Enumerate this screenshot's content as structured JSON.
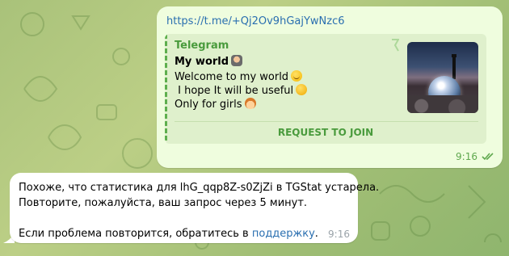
{
  "outgoing": {
    "link": "https://t.me/+Qj2Ov9hGajYwNzc6",
    "preview": {
      "site": "Telegram",
      "title": "My world",
      "lines": [
        "Welcome to my world",
        " I hope It will be useful",
        "Only for girls"
      ],
      "button": "REQUEST TO JOIN"
    },
    "time": "9:16",
    "status_icon": "double-check-icon"
  },
  "incoming": {
    "line1": "Похоже, что статистика для lhG_qqp8Z-s0ZjZi в TGStat устарела.",
    "line2": "Повторите, пожалуйста, ваш запрос через 5 минут.",
    "line3_prefix": "Если проблема повторится, обратитесь в ",
    "line3_link": "поддержку",
    "line3_suffix": ".",
    "time": "9:16"
  },
  "colors": {
    "outgoing_bubble": "#effdde",
    "incoming_bubble": "#ffffff",
    "link": "#2a6fb0",
    "accent_green": "#4a9b3d"
  }
}
